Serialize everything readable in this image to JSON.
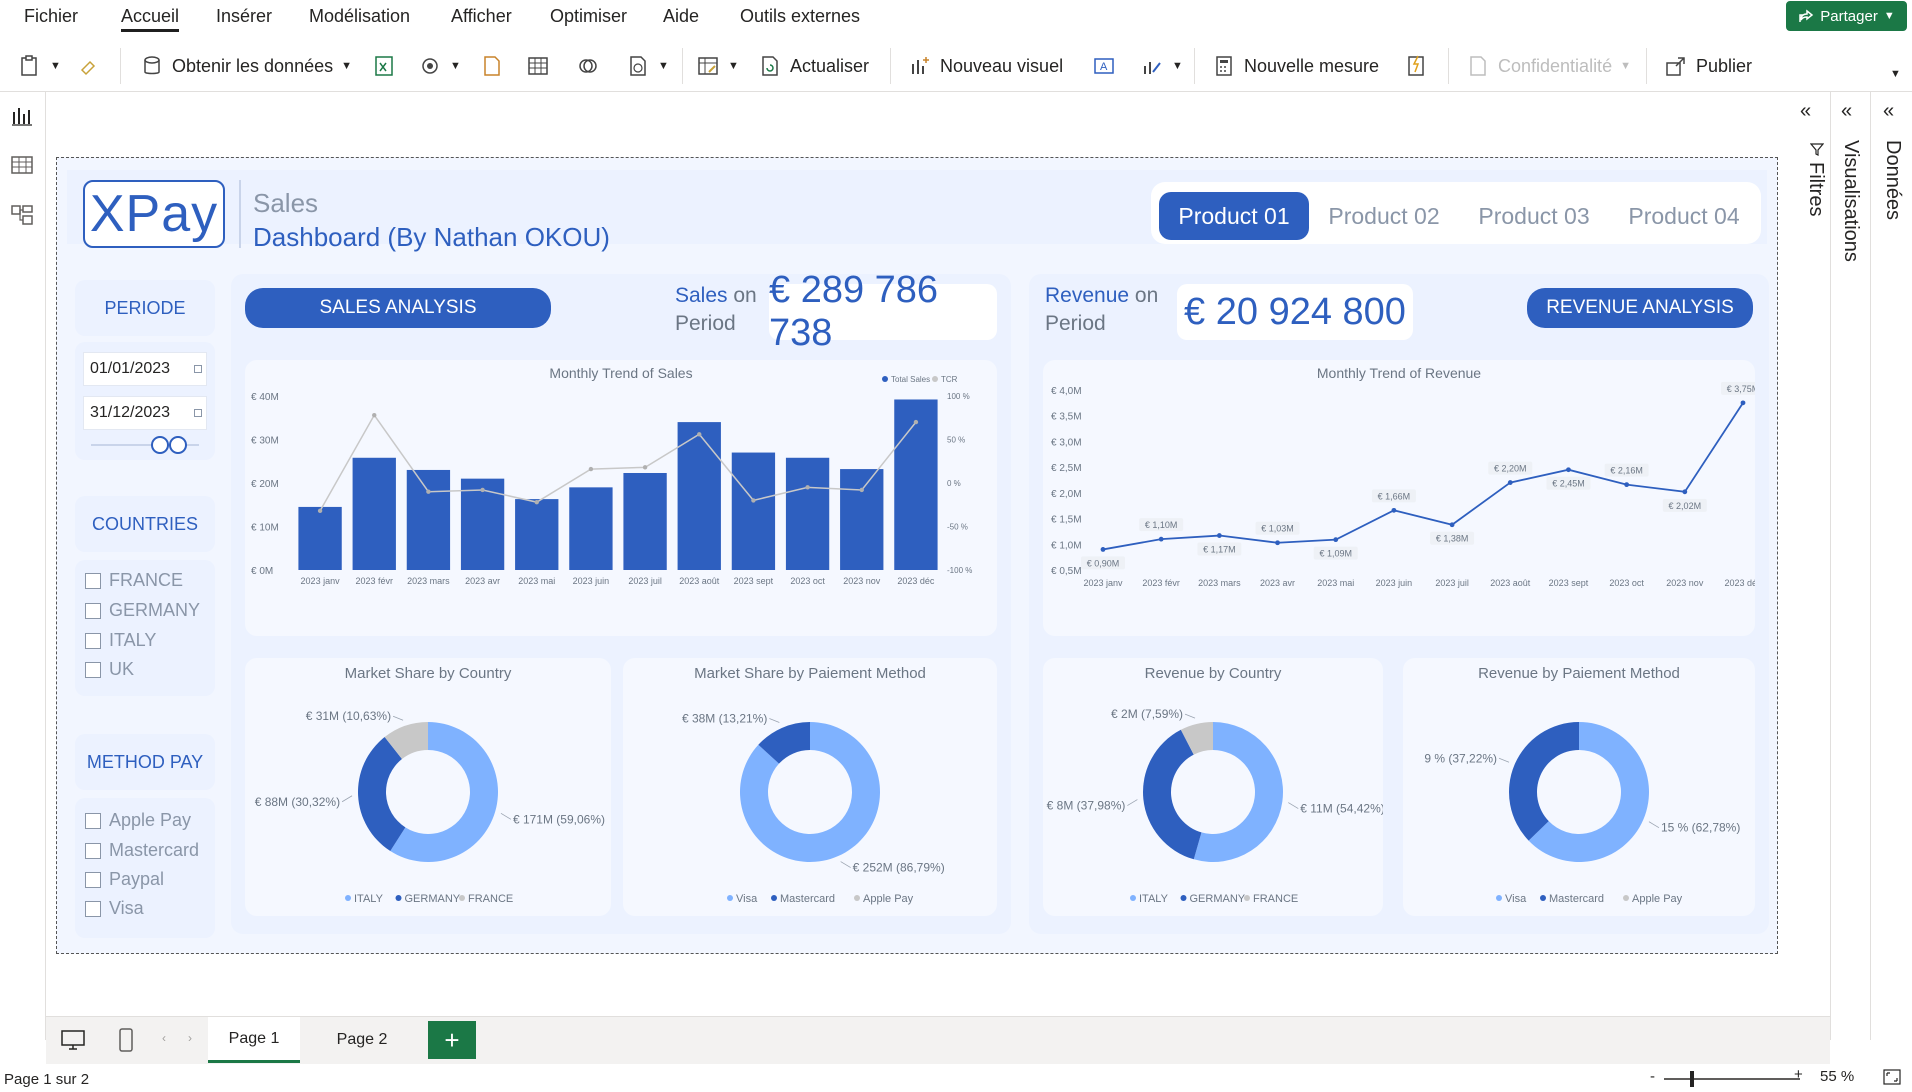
{
  "menu": {
    "items": [
      "Fichier",
      "Accueil",
      "Insérer",
      "Modélisation",
      "Afficher",
      "Optimiser",
      "Aide",
      "Outils externes"
    ],
    "share_label": "Partager"
  },
  "toolbar": {
    "get_data": "Obtenir les données",
    "refresh": "Actualiser",
    "new_visual": "Nouveau visuel",
    "new_measure": "Nouvelle mesure",
    "privacy": "Confidentialité",
    "publish": "Publier"
  },
  "panes": {
    "filters": "Filtres",
    "visualizations": "Visualisations",
    "data": "Données"
  },
  "report": {
    "logo": "XPay",
    "subtitle": "Sales",
    "title": "Dashboard (By Nathan OKOU)",
    "products": [
      "Product 01",
      "Product 02",
      "Product 03",
      "Product 04"
    ],
    "active_product": 0,
    "sidebar": {
      "period_label": "PERIODE",
      "date_start": "01/01/2023",
      "date_end": "31/12/2023",
      "countries_label": "COUNTRIES",
      "countries": [
        "FRANCE",
        "GERMANY",
        "ITALY",
        "UK"
      ],
      "method_label": "METHOD PAY",
      "methods": [
        "Apple Pay",
        "Mastercard",
        "Paypal",
        "Visa"
      ]
    },
    "sales_button": "SALES ANALYSIS",
    "sales_kpi_label_a": "Sales",
    "sales_kpi_label_b": "on",
    "sales_kpi_label_c": "Period",
    "sales_kpi_value": "€ 289 786 738",
    "revenue_button": "REVENUE ANALYSIS",
    "revenue_kpi_label_a": "Revenue",
    "revenue_kpi_label_b": "on",
    "revenue_kpi_label_c": "Period",
    "revenue_kpi_value": "€ 20 924 800"
  },
  "chart_data": [
    {
      "type": "bar",
      "title": "Monthly Trend of Sales",
      "categories": [
        "2023 janv",
        "2023 févr",
        "2023 mars",
        "2023 avr",
        "2023 mai",
        "2023 juin",
        "2023 juil",
        "2023 août",
        "2023 sept",
        "2023 oct",
        "2023 nov",
        "2023 déc"
      ],
      "y_ticks": [
        "€ 40M",
        "€ 30M",
        "€ 20M",
        "€ 10M",
        "€ 0M"
      ],
      "y2_ticks": [
        "100 %",
        "50 %",
        "0 %",
        "-50 %",
        "-100 %"
      ],
      "ylim": [
        0,
        40
      ],
      "y2lim": [
        -100,
        100
      ],
      "legend": [
        "Total Sales",
        "TCR"
      ],
      "series": [
        {
          "name": "Total Sales",
          "type": "bar",
          "values": [
            14.5,
            25.8,
            23.0,
            21.0,
            16.3,
            19.0,
            22.3,
            34.0,
            27.0,
            25.8,
            23.2,
            39.2
          ]
        },
        {
          "name": "TCR",
          "type": "line",
          "values": [
            -32,
            78,
            -10,
            -8,
            -22,
            16,
            18,
            56,
            -20,
            -5,
            -8,
            70
          ]
        }
      ]
    },
    {
      "type": "line",
      "title": "Monthly Trend of Revenue",
      "categories": [
        "2023 janv",
        "2023 févr",
        "2023 mars",
        "2023 avr",
        "2023 mai",
        "2023 juin",
        "2023 juil",
        "2023 août",
        "2023 sept",
        "2023 oct",
        "2023 nov",
        "2023 déc"
      ],
      "y_ticks": [
        "€ 4,0M",
        "€ 3,5M",
        "€ 3,0M",
        "€ 2,5M",
        "€ 2,0M",
        "€ 1,5M",
        "€ 1,0M",
        "€ 0,5M"
      ],
      "ylim": [
        0.5,
        4.0
      ],
      "values": [
        0.9,
        1.1,
        1.17,
        1.03,
        1.09,
        1.66,
        1.38,
        2.2,
        2.45,
        2.16,
        2.02,
        3.75
      ],
      "labels": [
        "€ 0,90M",
        "€ 1,10M",
        "€ 1,17M",
        "€ 1,03M",
        "€ 1,09M",
        "€ 1,66M",
        "€ 1,38M",
        "€ 2,20M",
        "€ 2,45M",
        "€ 2,16M",
        "€ 2,02M",
        "€ 3,75M"
      ]
    },
    {
      "type": "pie",
      "title": "Market Share by Country",
      "slices": [
        {
          "name": "ITALY",
          "value": 59.06,
          "label": "€ 171M (59,06%)",
          "color": "#7fb2ff"
        },
        {
          "name": "GERMANY",
          "value": 30.32,
          "label": "€ 88M (30,32%)",
          "color": "#2e5fbf"
        },
        {
          "name": "FRANCE",
          "value": 10.63,
          "label": "€ 31M (10,63%)",
          "color": "#c8c8c8"
        }
      ]
    },
    {
      "type": "pie",
      "title": "Market Share by Paiement Method",
      "slices": [
        {
          "name": "Visa",
          "value": 86.79,
          "label": "€ 252M (86,79%)",
          "color": "#7fb2ff"
        },
        {
          "name": "Mastercard",
          "value": 13.21,
          "label": "€ 38M (13,21%)",
          "color": "#2e5fbf"
        },
        {
          "name": "Apple Pay",
          "value": 0,
          "label": "",
          "color": "#c8c8c8"
        }
      ]
    },
    {
      "type": "pie",
      "title": "Revenue by Country",
      "slices": [
        {
          "name": "ITALY",
          "value": 54.42,
          "label": "€ 11M (54,42%)",
          "color": "#7fb2ff"
        },
        {
          "name": "GERMANY",
          "value": 37.98,
          "label": "€ 8M (37,98%)",
          "color": "#2e5fbf"
        },
        {
          "name": "FRANCE",
          "value": 7.59,
          "label": "€ 2M (7,59%)",
          "color": "#c8c8c8"
        }
      ]
    },
    {
      "type": "pie",
      "title": "Revenue by Paiement Method",
      "slices": [
        {
          "name": "Visa",
          "value": 62.78,
          "label": "15 % (62,78%)",
          "color": "#7fb2ff"
        },
        {
          "name": "Mastercard",
          "value": 37.22,
          "label": "9 % (37,22%)",
          "color": "#2e5fbf"
        },
        {
          "name": "Apple Pay",
          "value": 0,
          "label": "",
          "color": "#c8c8c8"
        }
      ]
    }
  ],
  "pages": {
    "tabs": [
      "Page 1",
      "Page 2"
    ],
    "add": "+",
    "status": "Page 1 sur 2",
    "zoom": "55 %"
  },
  "colors": {
    "accent": "#2e5fbf",
    "light_blue": "#7fb2ff",
    "grey": "#c8c8c8",
    "share_green": "#1b7846"
  }
}
